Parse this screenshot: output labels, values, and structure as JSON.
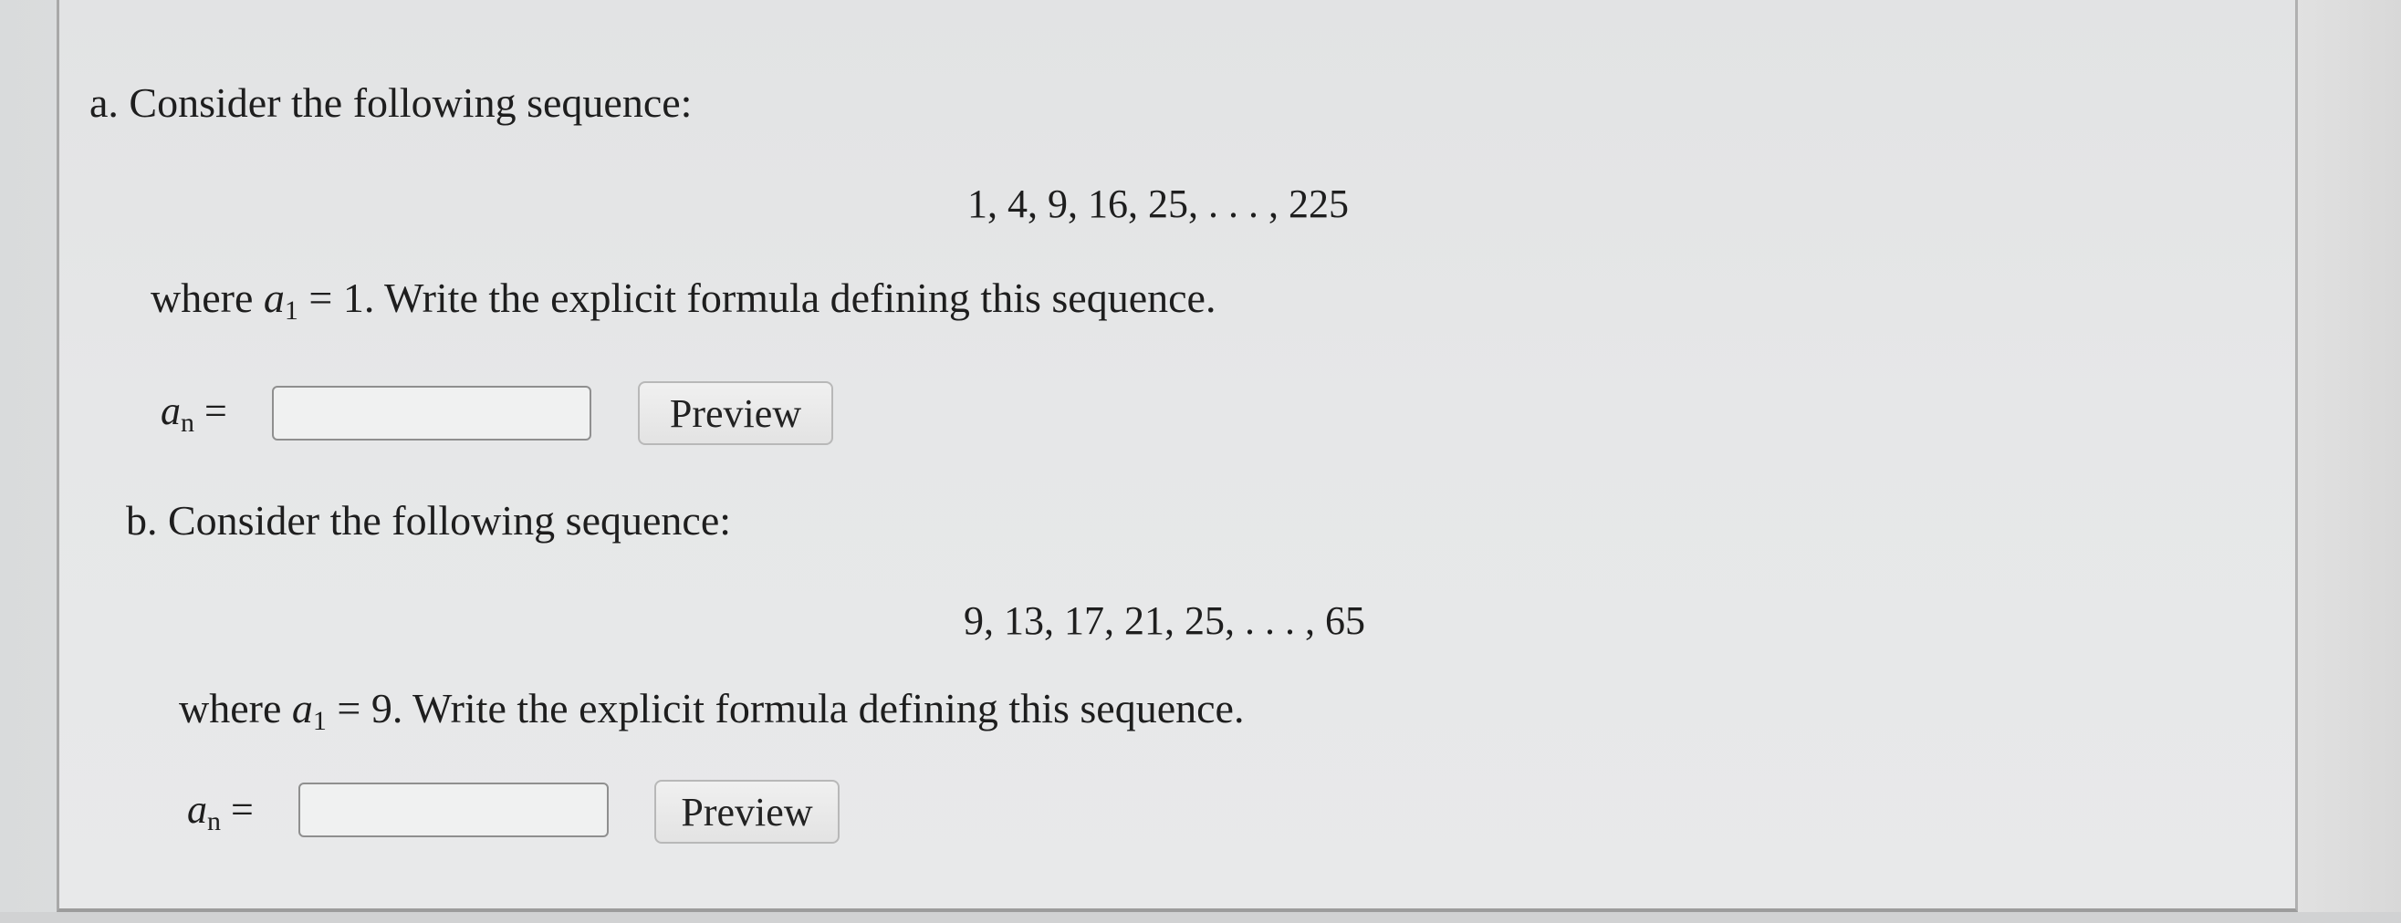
{
  "part_a": {
    "prompt": "a. Consider the following sequence:",
    "sequence": "1, 4, 9, 16, 25, . . . , 225",
    "where_prefix": "where",
    "a_symbol": "a",
    "a_subscript": "1",
    "condition_value": "= 1.",
    "instruction": "Write the explicit formula defining this sequence.",
    "answer_label_symbol": "a",
    "answer_label_subscript": "n",
    "answer_label_equals": "=",
    "answer_value": "",
    "preview_label": "Preview"
  },
  "part_b": {
    "prompt": "b. Consider the following sequence:",
    "sequence": "9, 13, 17, 21, 25, . . . , 65",
    "where_prefix": "where",
    "a_symbol": "a",
    "a_subscript": "1",
    "condition_value": "= 9.",
    "instruction": "Write the explicit formula defining this sequence.",
    "answer_label_symbol": "a",
    "answer_label_subscript": "n",
    "answer_label_equals": "=",
    "answer_value": "",
    "preview_label": "Preview"
  }
}
